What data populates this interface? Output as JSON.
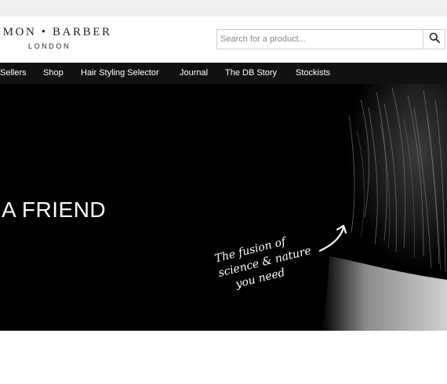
{
  "brand": {
    "name": "IMON • BARBER",
    "sub": "LONDON"
  },
  "search": {
    "placeholder": "Search for a product...",
    "button_icon": "search-icon"
  },
  "nav": {
    "items": [
      {
        "label": "Sellers"
      },
      {
        "label": "Shop"
      },
      {
        "label": "Hair Styling Selector"
      },
      {
        "label": "Journal"
      },
      {
        "label": "The DB Story"
      },
      {
        "label": "Stockists"
      }
    ]
  },
  "hero": {
    "title": "A FRIEND",
    "tagline": [
      "The fusion of",
      "science & nature",
      "you need"
    ]
  },
  "colors": {
    "nav_bg": "#111111",
    "hero_bg": "#000000",
    "topbar_bg": "#efefef"
  }
}
